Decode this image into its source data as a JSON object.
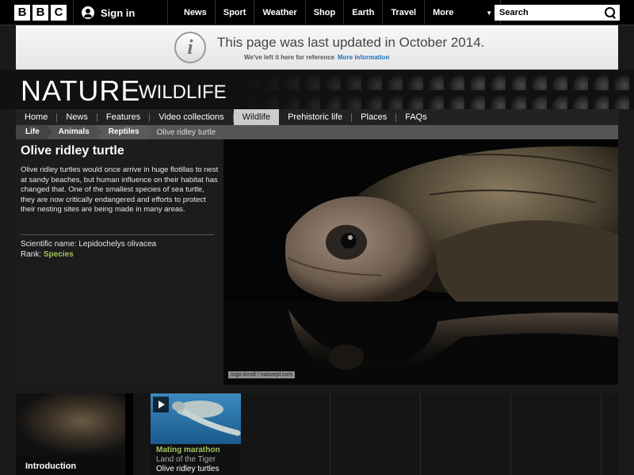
{
  "masthead": {
    "logo_letters": [
      "B",
      "B",
      "C"
    ],
    "signin_label": "Sign in",
    "nav": [
      "News",
      "Sport",
      "Weather",
      "Shop",
      "Earth",
      "Travel"
    ],
    "more_label": "More",
    "search_placeholder": "Search"
  },
  "notice": {
    "title": "This page was last updated in October 2014.",
    "note": "We've left it here for reference",
    "link": "More information"
  },
  "header": {
    "title": "NATURE",
    "subtitle": "WILDLIFE"
  },
  "section_nav": {
    "items": [
      "Home",
      "News",
      "Features",
      "Video collections",
      "Wildlife",
      "Prehistoric life",
      "Places",
      "FAQs"
    ],
    "active": "Wildlife"
  },
  "breadcrumb": {
    "items": [
      "Life",
      "Animals",
      "Reptiles"
    ],
    "current": "Olive ridley turtle"
  },
  "species": {
    "name": "Olive ridley turtle",
    "description": "Olive ridley turtles would once arrive in huge flotillas to nest at sandy beaches, but human influence on their habitat has changed that. One of the smallest species of sea turtle, they are now critically endangered and efforts to protect their nesting sites are being made in many areas.",
    "scientific_label": "Scientific name: Lepidochelys olivacea",
    "rank_label": "Rank:",
    "rank_value": "Species"
  },
  "photo": {
    "credit": "Ingo Arndt / naturepl.com"
  },
  "bottom": {
    "intro_label": "Introduction",
    "video": {
      "title": "Mating marathon",
      "programme": "Land of the Tiger",
      "subject": "Olive ridley turtles"
    }
  }
}
